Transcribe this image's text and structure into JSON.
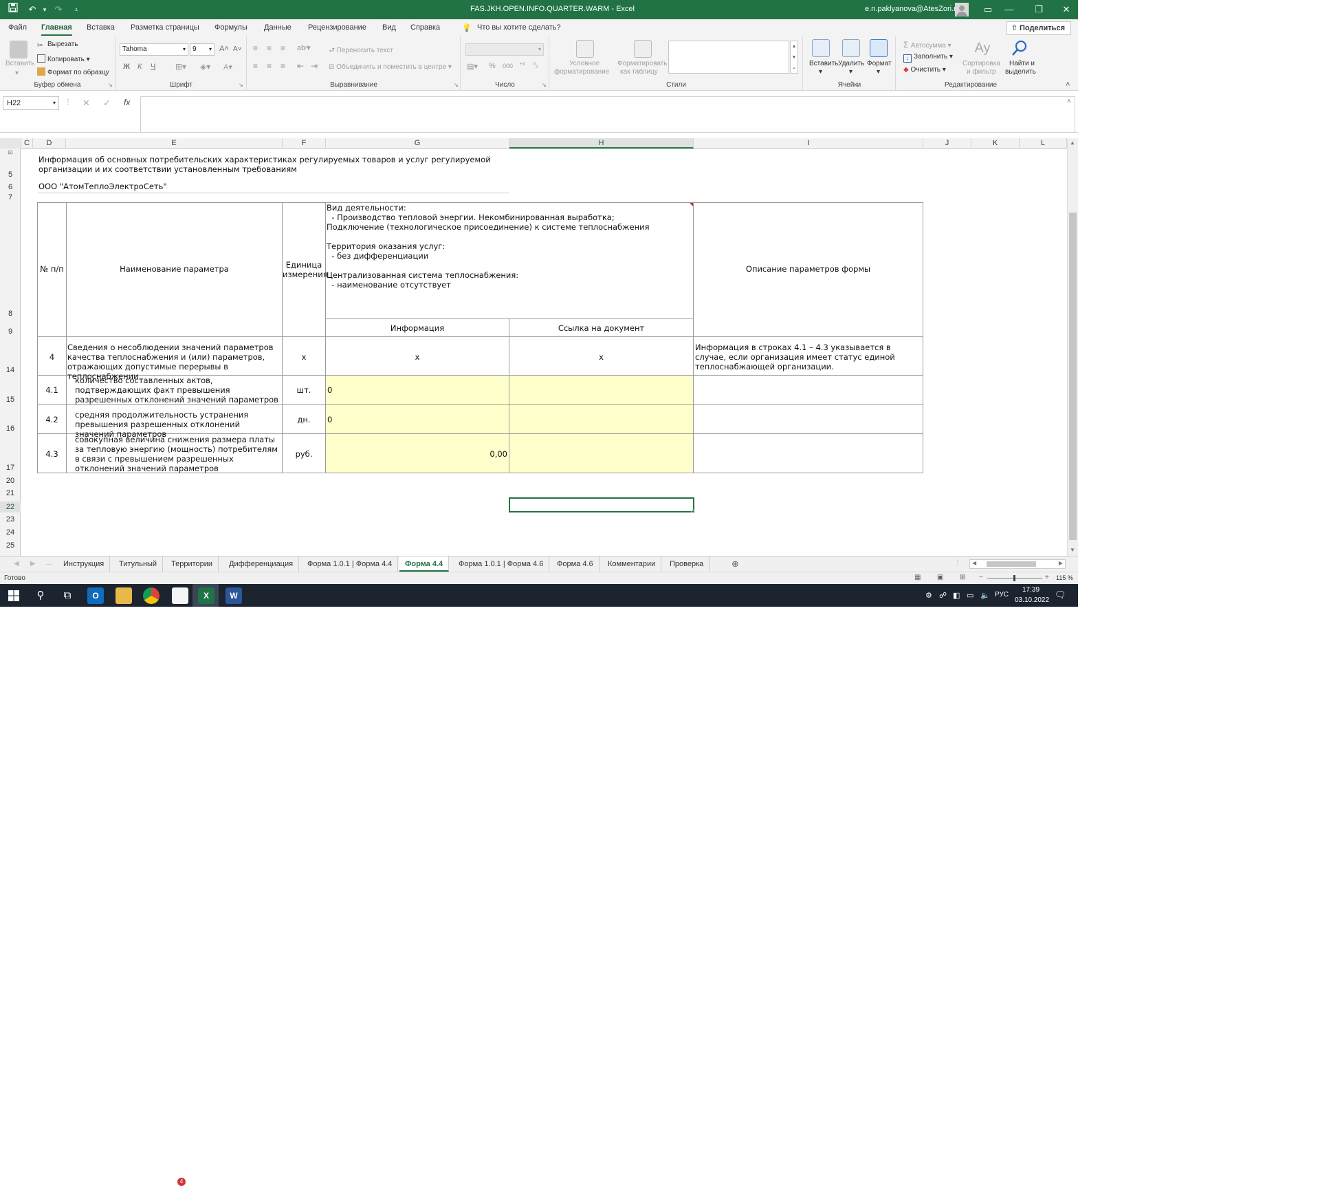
{
  "title_bar": {
    "doc_title": "FAS.JKH.OPEN.INFO.QUARTER.WARM  -  Excel",
    "user": "e.n.paklyanova@AtesZori.ru",
    "colors": {
      "accent": "#217346"
    }
  },
  "menu": {
    "items": [
      "Файл",
      "Главная",
      "Вставка",
      "Разметка страницы",
      "Формулы",
      "Данные",
      "Рецензирование",
      "Вид",
      "Справка"
    ],
    "active": "Главная",
    "tell_me": "Что вы хотите сделать?",
    "share": "Поделиться"
  },
  "ribbon": {
    "clipboard": {
      "paste": "Вставить",
      "cut": "Вырезать",
      "copy": "Копировать",
      "format_painter": "Формат по образцу",
      "group": "Буфер обмена"
    },
    "font": {
      "name": "Tahoma",
      "size": "9",
      "bold": "Ж",
      "italic": "К",
      "underline": "Ч",
      "group": "Шрифт"
    },
    "alignment": {
      "wrap": "Переносить текст",
      "merge": "Объединить и поместить в центре",
      "group": "Выравнивание"
    },
    "number": {
      "percent": "%",
      "thousands": "000",
      "group": "Число"
    },
    "styles": {
      "conditional1": "Условное",
      "conditional2": "форматирование",
      "table1": "Форматировать",
      "table2": "как таблицу",
      "group": "Стили"
    },
    "cells": {
      "insert": "Вставить",
      "delete": "Удалить",
      "format": "Формат",
      "group": "Ячейки"
    },
    "editing": {
      "autosum": "Автосумма",
      "fill": "Заполнить",
      "clear": "Очистить",
      "sort1": "Сортировка",
      "sort2": "и фильтр",
      "find1": "Найти и",
      "find2": "выделить",
      "group": "Редактирование"
    }
  },
  "formula_bar": {
    "name_box": "H22",
    "fx": "fx",
    "value": ""
  },
  "columns": [
    "C",
    "D",
    "E",
    "F",
    "G",
    "H",
    "I",
    "J",
    "K",
    "L"
  ],
  "selected_column": "H",
  "rows": [
    "5",
    "6",
    "7",
    "8",
    "9",
    "14",
    "15",
    "16",
    "17",
    "20",
    "21",
    "22",
    "23",
    "24",
    "25"
  ],
  "selected_row": "22",
  "sheet": {
    "heading": "Информация об основных потребительских характеристиках регулируемых товаров и услуг регулируемой организации и их соответствии установленным требованиям",
    "org": "ООО \"АтомТеплоЭлектроСеть\"",
    "header": {
      "num": "№ п/п",
      "param": "Наименование параметра",
      "unit": "Единица измерения",
      "activity_label": "Вид деятельности:",
      "activity_value": "  - Производство тепловой энергии. Некомбинированная выработка; Подключение (технологическое присоединение) к системе теплоснабжения",
      "territory_label": "Территория оказания услуг:",
      "territory_value": "  - без дифференциации",
      "system_label": "Централизованная система теплоснабжения:",
      "system_value": "  - наименование отсутствует",
      "info": "Информация",
      "link": "Ссылка на документ",
      "desc": "Описание параметров формы"
    },
    "rows": [
      {
        "num": "4",
        "name": "Сведения о несоблюдении значений параметров качества теплоснабжения и (или) параметров, отражающих допустимые перерывы в теплоснабжении",
        "unit": "x",
        "info": "x",
        "link": "x",
        "desc": "Информация в строках 4.1 – 4.3 указывается в случае, если организация имеет статус единой теплоснабжающей организации."
      },
      {
        "num": "4.1",
        "name": "количество составленных актов, подтверждающих факт превышения разрешенных отклонений значений параметров",
        "unit": "шт.",
        "info": "0",
        "link": "",
        "desc": ""
      },
      {
        "num": "4.2",
        "name": "средняя продолжительность устранения превышения разрешенных отклонений значений параметров",
        "unit": "дн.",
        "info": "0",
        "link": "",
        "desc": ""
      },
      {
        "num": "4.3",
        "name": "совокупная величина снижения размера платы за тепловую энергию (мощность) потребителям в связи с превышением разрешенных отклонений значений параметров",
        "unit": "руб.",
        "info": "0,00",
        "link": "",
        "desc": ""
      }
    ],
    "input_fill": "#ffffcc"
  },
  "sheet_tabs": [
    "Инструкция",
    "Титульный",
    "Территории",
    "Дифференциация",
    "Форма 1.0.1 | Форма 4.4",
    "Форма 4.4",
    "Форма 1.0.1 | Форма 4.6",
    "Форма 4.6",
    "Комментарии",
    "Проверка"
  ],
  "active_tab": "Форма 4.4",
  "status": {
    "ready": "Готово",
    "zoom": "115 %"
  },
  "taskbar": {
    "lang": "РУС",
    "time": "17:39",
    "date": "03.10.2022",
    "notif": "9",
    "mail_badge": "4"
  }
}
